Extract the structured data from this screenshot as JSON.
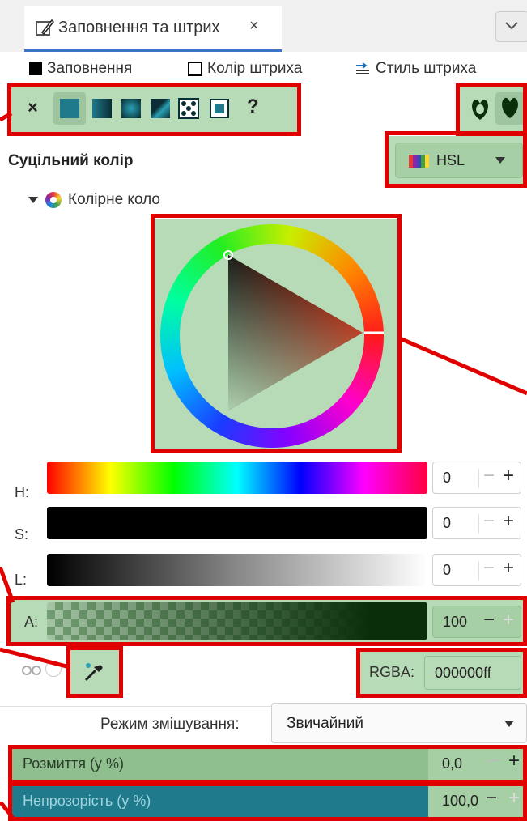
{
  "doc_tab": {
    "title": "Заповнення та штрих",
    "close": "×"
  },
  "subtabs": {
    "fill": "Заповнення",
    "stroke_paint": "Колір штриха",
    "stroke_style": "Стиль штриха"
  },
  "fill_toolbar": {
    "none": "×",
    "unknown": "?"
  },
  "section_title": "Суцільний колір",
  "color_mode": {
    "value": "HSL"
  },
  "wheel_expander": {
    "label": "Колірне коло"
  },
  "sliders": [
    {
      "label": "H:",
      "value": "0"
    },
    {
      "label": "S:",
      "value": "0"
    },
    {
      "label": "L:",
      "value": "0"
    },
    {
      "label": "A:",
      "value": "100"
    }
  ],
  "rgba": {
    "label": "RGBA:",
    "value": "000000ff"
  },
  "blend": {
    "label": "Режим змішування:",
    "value": "Звичайний"
  },
  "blur": {
    "label": "Розмиття (у %)",
    "value": "0,0"
  },
  "opacity": {
    "label": "Непрозорість (у %)",
    "value": "100,0"
  },
  "colors": {
    "highlight": "#e00000",
    "green_overlay": "#b7dbb6",
    "accent": "#1f7a8c"
  }
}
